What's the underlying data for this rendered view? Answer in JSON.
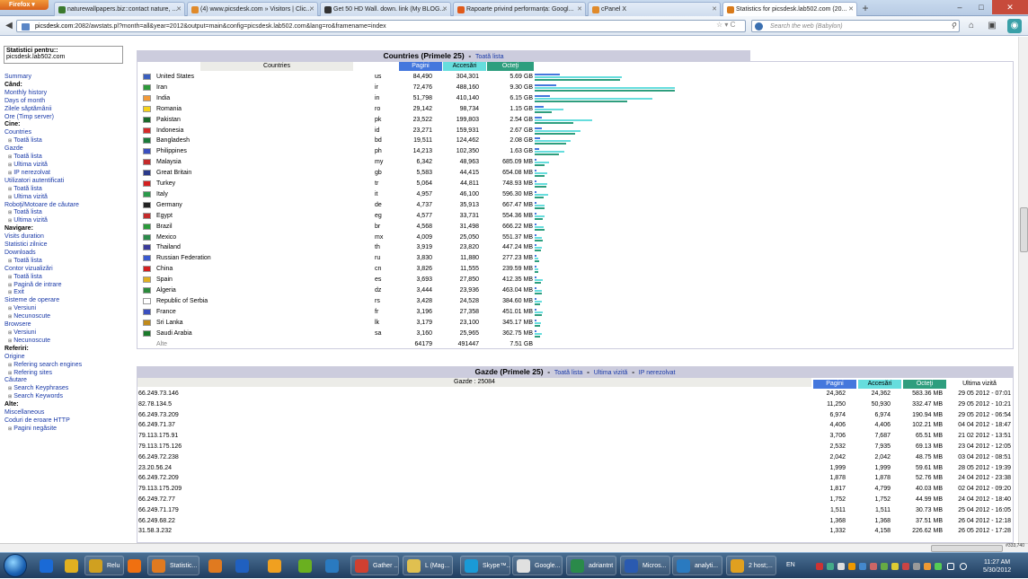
{
  "browser": {
    "menu_label": "Firefox",
    "tabs": [
      {
        "title": "naturewallpapers.biz::contact nature, ...",
        "color": "#3c7a2e"
      },
      {
        "title": "(4) www.picsdesk.com » Visitors | Clic...",
        "color": "#e08a2a"
      },
      {
        "title": "Get 50 HD Wall. down. link (My BLOG...",
        "color": "#333333"
      },
      {
        "title": "Rapoarte privind performanța: Googl...",
        "color": "#e05a1a"
      },
      {
        "title": "cPanel X",
        "color": "#e08a2a"
      },
      {
        "title": "Statistics for picsdesk.lab502.com (20...",
        "color": "#d87a1a"
      }
    ],
    "url_host": "picsdesk.com",
    "url_rest": ":2082/awstats.pl?month=all&year=2012&output=main&config=picsdesk.lab502.com&lang=ro&framename=index",
    "search_placeholder": "Search the web (Babylon)"
  },
  "left": {
    "stats_for_label": "Statistici pentru::",
    "stats_for_value": "picsdesk.lab502.com",
    "items": [
      {
        "t": "Summary",
        "k": "link"
      },
      {
        "t": "Când:",
        "k": "hd"
      },
      {
        "t": "Monthly history",
        "k": "link"
      },
      {
        "t": "Days of month",
        "k": "link"
      },
      {
        "t": "Zilele săptămânii",
        "k": "link"
      },
      {
        "t": "Ore (Timp server)",
        "k": "link"
      },
      {
        "t": "Cine:",
        "k": "hd"
      },
      {
        "t": "Countries",
        "k": "link"
      },
      {
        "t": "Toată lista",
        "k": "sub"
      },
      {
        "t": "Gazde",
        "k": "link"
      },
      {
        "t": "Toată lista",
        "k": "sub"
      },
      {
        "t": "Ultima vizită",
        "k": "sub"
      },
      {
        "t": "IP nerezolvat",
        "k": "sub"
      },
      {
        "t": "Utilizatori autentificati",
        "k": "link"
      },
      {
        "t": "Toată lista",
        "k": "sub"
      },
      {
        "t": "Ultima vizită",
        "k": "sub"
      },
      {
        "t": "Roboţi/Motoare de căutare",
        "k": "link"
      },
      {
        "t": "Toată lista",
        "k": "sub"
      },
      {
        "t": "Ultima vizită",
        "k": "sub"
      },
      {
        "t": "Navigare:",
        "k": "hd"
      },
      {
        "t": "Visits duration",
        "k": "link"
      },
      {
        "t": "Statistici zilnice",
        "k": "link"
      },
      {
        "t": "Downloads",
        "k": "link"
      },
      {
        "t": "Toată lista",
        "k": "sub"
      },
      {
        "t": "Contor vizualizări",
        "k": "link"
      },
      {
        "t": "Toată lista",
        "k": "sub"
      },
      {
        "t": "Pagină de intrare",
        "k": "sub"
      },
      {
        "t": "Exit",
        "k": "sub"
      },
      {
        "t": "Sisteme de operare",
        "k": "link"
      },
      {
        "t": "Versiuni",
        "k": "sub"
      },
      {
        "t": "Necunoscute",
        "k": "sub"
      },
      {
        "t": "Browsere",
        "k": "link"
      },
      {
        "t": "Versiuni",
        "k": "sub"
      },
      {
        "t": "Necunoscute",
        "k": "sub"
      },
      {
        "t": "Referiri:",
        "k": "hd"
      },
      {
        "t": "Origine",
        "k": "link"
      },
      {
        "t": "Refering search engines",
        "k": "sub"
      },
      {
        "t": "Refering sites",
        "k": "sub"
      },
      {
        "t": "Căutare",
        "k": "link"
      },
      {
        "t": "Search Keyphrases",
        "k": "sub"
      },
      {
        "t": "Search Keywords",
        "k": "sub"
      },
      {
        "t": "Alte:",
        "k": "hd"
      },
      {
        "t": "Miscellaneous",
        "k": "link"
      },
      {
        "t": "Coduri de eroare HTTP",
        "k": "link"
      },
      {
        "t": "Pagini negăsite",
        "k": "sub"
      }
    ]
  },
  "countries": {
    "title": "Countries (Primele 25)",
    "dash": "-",
    "full_list": "Toată lista",
    "col_countries": "Countries",
    "col_pages": "Pagini",
    "col_hits": "Accesări",
    "col_bytes": "Octeţi",
    "rows": [
      {
        "name": "United States",
        "code": "us",
        "pages": "84,490",
        "hits": "304,301",
        "bytes": "5.69 GB",
        "p": 84490,
        "h": 304301,
        "b": 5.69,
        "flag": "#3a5fbf"
      },
      {
        "name": "Iran",
        "code": "ir",
        "pages": "72,476",
        "hits": "488,160",
        "bytes": "9.30 GB",
        "p": 72476,
        "h": 488160,
        "b": 9.3,
        "flag": "#2c9a3a"
      },
      {
        "name": "India",
        "code": "in",
        "pages": "51,798",
        "hits": "410,140",
        "bytes": "6.15 GB",
        "p": 51798,
        "h": 410140,
        "b": 6.15,
        "flag": "#f29a3a"
      },
      {
        "name": "Romania",
        "code": "ro",
        "pages": "29,142",
        "hits": "98,734",
        "bytes": "1.15 GB",
        "p": 29142,
        "h": 98734,
        "b": 1.15,
        "flag": "#f5d21a"
      },
      {
        "name": "Pakistan",
        "code": "pk",
        "pages": "23,522",
        "hits": "199,803",
        "bytes": "2.54 GB",
        "p": 23522,
        "h": 199803,
        "b": 2.54,
        "flag": "#1a6a2a"
      },
      {
        "name": "Indonesia",
        "code": "id",
        "pages": "23,271",
        "hits": "159,931",
        "bytes": "2.67 GB",
        "p": 23271,
        "h": 159931,
        "b": 2.67,
        "flag": "#d42a2a"
      },
      {
        "name": "Bangladesh",
        "code": "bd",
        "pages": "19,511",
        "hits": "124,462",
        "bytes": "2.08 GB",
        "p": 19511,
        "h": 124462,
        "b": 2.08,
        "flag": "#1a7a3a"
      },
      {
        "name": "Philippines",
        "code": "ph",
        "pages": "14,213",
        "hits": "102,350",
        "bytes": "1.63 GB",
        "p": 14213,
        "h": 102350,
        "b": 1.63,
        "flag": "#3a4fbf"
      },
      {
        "name": "Malaysia",
        "code": "my",
        "pages": "6,342",
        "hits": "48,963",
        "bytes": "685.09 MB",
        "p": 6342,
        "h": 48963,
        "b": 0.685,
        "flag": "#c42a2a"
      },
      {
        "name": "Great Britain",
        "code": "gb",
        "pages": "5,583",
        "hits": "44,415",
        "bytes": "654.08 MB",
        "p": 5583,
        "h": 44415,
        "b": 0.654,
        "flag": "#2a3a8a"
      },
      {
        "name": "Turkey",
        "code": "tr",
        "pages": "5,064",
        "hits": "44,811",
        "bytes": "748.93 MB",
        "p": 5064,
        "h": 44811,
        "b": 0.749,
        "flag": "#d42020"
      },
      {
        "name": "Italy",
        "code": "it",
        "pages": "4,957",
        "hits": "46,100",
        "bytes": "596.30 MB",
        "p": 4957,
        "h": 46100,
        "b": 0.596,
        "flag": "#2a9a4a"
      },
      {
        "name": "Germany",
        "code": "de",
        "pages": "4,737",
        "hits": "35,913",
        "bytes": "667.47 MB",
        "p": 4737,
        "h": 35913,
        "b": 0.667,
        "flag": "#222222"
      },
      {
        "name": "Egypt",
        "code": "eg",
        "pages": "4,577",
        "hits": "33,731",
        "bytes": "554.36 MB",
        "p": 4577,
        "h": 33731,
        "b": 0.554,
        "flag": "#c42a2a"
      },
      {
        "name": "Brazil",
        "code": "br",
        "pages": "4,568",
        "hits": "31,498",
        "bytes": "666.22 MB",
        "p": 4568,
        "h": 31498,
        "b": 0.666,
        "flag": "#2a9a3a"
      },
      {
        "name": "Mexico",
        "code": "mx",
        "pages": "4,009",
        "hits": "25,050",
        "bytes": "551.37 MB",
        "p": 4009,
        "h": 25050,
        "b": 0.551,
        "flag": "#2a8a4a"
      },
      {
        "name": "Thailand",
        "code": "th",
        "pages": "3,919",
        "hits": "23,820",
        "bytes": "447.24 MB",
        "p": 3919,
        "h": 23820,
        "b": 0.447,
        "flag": "#3a3a9a"
      },
      {
        "name": "Russian Federation",
        "code": "ru",
        "pages": "3,830",
        "hits": "11,880",
        "bytes": "277.23 MB",
        "p": 3830,
        "h": 11880,
        "b": 0.277,
        "flag": "#3a5acf"
      },
      {
        "name": "China",
        "code": "cn",
        "pages": "3,826",
        "hits": "11,555",
        "bytes": "239.59 MB",
        "p": 3826,
        "h": 11555,
        "b": 0.24,
        "flag": "#d42020"
      },
      {
        "name": "Spain",
        "code": "es",
        "pages": "3,693",
        "hits": "27,850",
        "bytes": "412.35 MB",
        "p": 3693,
        "h": 27850,
        "b": 0.412,
        "flag": "#e0b020"
      },
      {
        "name": "Algeria",
        "code": "dz",
        "pages": "3,444",
        "hits": "23,936",
        "bytes": "463.04 MB",
        "p": 3444,
        "h": 23936,
        "b": 0.463,
        "flag": "#2a8a3a"
      },
      {
        "name": "Republic of Serbia",
        "code": "rs",
        "pages": "3,428",
        "hits": "24,528",
        "bytes": "384.60 MB",
        "p": 3428,
        "h": 24528,
        "b": 0.385,
        "flag": "#ffffff"
      },
      {
        "name": "France",
        "code": "fr",
        "pages": "3,196",
        "hits": "27,358",
        "bytes": "451.01 MB",
        "p": 3196,
        "h": 27358,
        "b": 0.451,
        "flag": "#3a4fbf"
      },
      {
        "name": "Sri Lanka",
        "code": "lk",
        "pages": "3,179",
        "hits": "23,100",
        "bytes": "345.17 MB",
        "p": 3179,
        "h": 23100,
        "b": 0.345,
        "flag": "#c08a1a"
      },
      {
        "name": "Saudi Arabia",
        "code": "sa",
        "pages": "3,160",
        "hits": "25,965",
        "bytes": "362.75 MB",
        "p": 3160,
        "h": 25965,
        "b": 0.363,
        "flag": "#1a7a2a"
      }
    ],
    "other": {
      "name": "Alte",
      "pages": "64179",
      "hits": "491447",
      "bytes": "7.51 GB"
    }
  },
  "hosts": {
    "title": "Gazde (Primele 25)",
    "dash": "-",
    "full_list": "Toată lista",
    "last_visit_link": "Ultima vizită",
    "unresolved_link": "IP nerezolvat",
    "count_label": "Gazde : 25084",
    "col_pages": "Pagini",
    "col_hits": "Accesări",
    "col_bytes": "Octeţi",
    "col_last": "Ultima vizită",
    "rows": [
      {
        "ip": "66.249.73.146",
        "pages": "24,362",
        "hits": "24,362",
        "bytes": "583.36 MB",
        "last": "29 05 2012 - 07:01"
      },
      {
        "ip": "82.78.134.5",
        "pages": "11,250",
        "hits": "50,930",
        "bytes": "332.47 MB",
        "last": "29 05 2012 - 10:21"
      },
      {
        "ip": "66.249.73.209",
        "pages": "6,974",
        "hits": "6,974",
        "bytes": "190.94 MB",
        "last": "29 05 2012 - 06:54"
      },
      {
        "ip": "66.249.71.37",
        "pages": "4,406",
        "hits": "4,406",
        "bytes": "102.21 MB",
        "last": "04 04 2012 - 18:47"
      },
      {
        "ip": "79.113.175.91",
        "pages": "3,706",
        "hits": "7,687",
        "bytes": "65.51 MB",
        "last": "21 02 2012 - 13:51"
      },
      {
        "ip": "79.113.175.126",
        "pages": "2,532",
        "hits": "7,935",
        "bytes": "69.13 MB",
        "last": "23 04 2012 - 12:05"
      },
      {
        "ip": "66.249.72.238",
        "pages": "2,042",
        "hits": "2,042",
        "bytes": "48.75 MB",
        "last": "03 04 2012 - 08:51"
      },
      {
        "ip": "23.20.56.24",
        "pages": "1,999",
        "hits": "1,999",
        "bytes": "59.61 MB",
        "last": "28 05 2012 - 19:39"
      },
      {
        "ip": "66.249.72.209",
        "pages": "1,878",
        "hits": "1,878",
        "bytes": "52.76 MB",
        "last": "24 04 2012 - 23:38"
      },
      {
        "ip": "79.113.175.209",
        "pages": "1,817",
        "hits": "4,799",
        "bytes": "40.03 MB",
        "last": "02 04 2012 - 09:20"
      },
      {
        "ip": "66.249.72.77",
        "pages": "1,752",
        "hits": "1,752",
        "bytes": "44.99 MB",
        "last": "24 04 2012 - 18:40"
      },
      {
        "ip": "66.249.71.179",
        "pages": "1,511",
        "hits": "1,511",
        "bytes": "30.73 MB",
        "last": "25 04 2012 - 16:05"
      },
      {
        "ip": "66.249.68.22",
        "pages": "1,368",
        "hits": "1,368",
        "bytes": "37.51 MB",
        "last": "26 04 2012 - 12:18"
      },
      {
        "ip": "31.58.3.232",
        "pages": "1,332",
        "hits": "4,158",
        "bytes": "226.62 MB",
        "last": "26 05 2012 - 17:28"
      }
    ]
  },
  "statusbar": {
    "zoom": "#333,740"
  },
  "taskbar": {
    "items": [
      {
        "label": "Relu",
        "color": "#d0a020"
      },
      {
        "label": "Statistic...",
        "color": "#e07a20"
      },
      {
        "label": "Gather ...",
        "color": "#d04030"
      },
      {
        "label": "L (Mag...",
        "color": "#e0c050"
      },
      {
        "label": "Skype™...",
        "color": "#1a9ad6"
      },
      {
        "label": "Google...",
        "color": "#e0e0e0"
      },
      {
        "label": "adriantnt",
        "color": "#2a8a4a"
      },
      {
        "label": "Micros...",
        "color": "#2a5ab0"
      },
      {
        "label": "analyti...",
        "color": "#2a7ac0"
      },
      {
        "label": "2 host;...",
        "color": "#e0a020"
      }
    ],
    "lang": "EN",
    "time": "11:27 AM",
    "date": "5/30/2012"
  },
  "colors": {
    "pages": "#4477dd",
    "hits": "#66dddd",
    "bytes": "#2e9e7e",
    "header": "#ccccdd",
    "link": "#1a3aa8"
  }
}
